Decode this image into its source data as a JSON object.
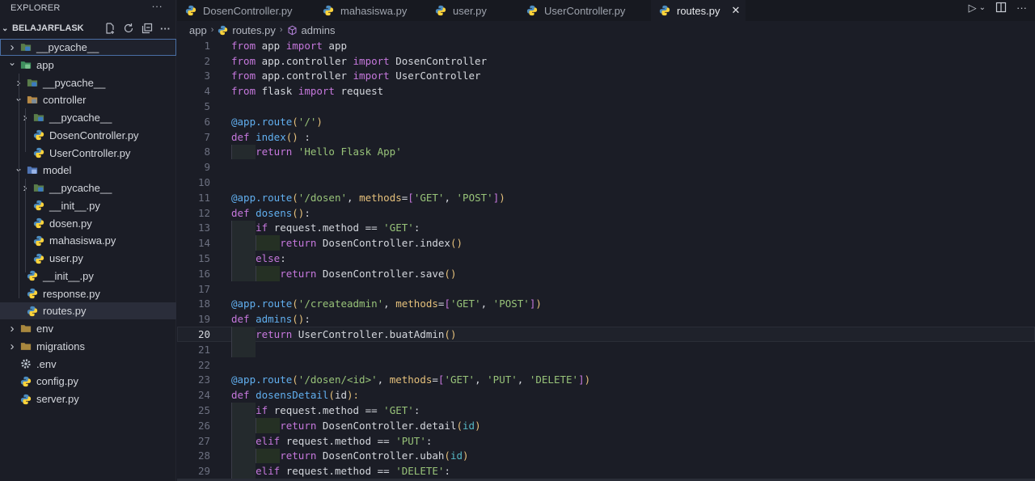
{
  "explorer": {
    "title": "EXPLORER",
    "more": "···",
    "project": "BELAJARFLASK",
    "actions": [
      "new-file-icon",
      "refresh-icon",
      "collapse-icon",
      "more-icon"
    ],
    "tree": [
      {
        "label": "__pycache__",
        "type": "pyfolder",
        "depth": 0,
        "chev": "›",
        "focused": true
      },
      {
        "label": "app",
        "type": "appfolder",
        "depth": 0,
        "chev": "⌄"
      },
      {
        "label": "__pycache__",
        "type": "pyfolder",
        "depth": 1,
        "chev": "›"
      },
      {
        "label": "controller",
        "type": "ctrlfolder",
        "depth": 1,
        "chev": "⌄"
      },
      {
        "label": "__pycache__",
        "type": "pyfolder",
        "depth": 2,
        "chev": "›"
      },
      {
        "label": "DosenController.py",
        "type": "py",
        "depth": 2
      },
      {
        "label": "UserController.py",
        "type": "py",
        "depth": 2
      },
      {
        "label": "model",
        "type": "modelfolder",
        "depth": 1,
        "chev": "⌄"
      },
      {
        "label": "__pycache__",
        "type": "pyfolder",
        "depth": 2,
        "chev": "›"
      },
      {
        "label": "__init__.py",
        "type": "py",
        "depth": 2
      },
      {
        "label": "dosen.py",
        "type": "py",
        "depth": 2
      },
      {
        "label": "mahasiswa.py",
        "type": "py",
        "depth": 2
      },
      {
        "label": "user.py",
        "type": "py",
        "depth": 2
      },
      {
        "label": "__init__.py",
        "type": "py",
        "depth": 1
      },
      {
        "label": "response.py",
        "type": "py",
        "depth": 1
      },
      {
        "label": "routes.py",
        "type": "py",
        "depth": 1,
        "selected": true
      },
      {
        "label": "env",
        "type": "folder",
        "depth": 0,
        "chev": "›"
      },
      {
        "label": "migrations",
        "type": "folder",
        "depth": 0,
        "chev": "›"
      },
      {
        "label": ".env",
        "type": "gear",
        "depth": 0
      },
      {
        "label": "config.py",
        "type": "py",
        "depth": 0
      },
      {
        "label": "server.py",
        "type": "py",
        "depth": 0
      }
    ]
  },
  "tabs": [
    {
      "label": "DosenController.py",
      "active": false
    },
    {
      "label": "mahasiswa.py",
      "active": false
    },
    {
      "label": "user.py",
      "active": false
    },
    {
      "label": "UserController.py",
      "active": false
    },
    {
      "label": "routes.py",
      "active": true,
      "close": "✕"
    }
  ],
  "breadcrumb": {
    "folder": "app",
    "file": "routes.py",
    "symbol": "admins"
  },
  "editor": {
    "current_line": 20,
    "lines": [
      [
        [
          "kw",
          "from"
        ],
        [
          "op",
          " app "
        ],
        [
          "kw",
          "import"
        ],
        [
          "op",
          " app"
        ]
      ],
      [
        [
          "kw",
          "from"
        ],
        [
          "op",
          " app.controller "
        ],
        [
          "kw",
          "import"
        ],
        [
          "op",
          " DosenController"
        ]
      ],
      [
        [
          "kw",
          "from"
        ],
        [
          "op",
          " app.controller "
        ],
        [
          "kw",
          "import"
        ],
        [
          "op",
          " UserController"
        ]
      ],
      [
        [
          "kw",
          "from"
        ],
        [
          "op",
          " flask "
        ],
        [
          "kw",
          "import"
        ],
        [
          "op",
          " request"
        ]
      ],
      [],
      [
        [
          "dec",
          "@app.route"
        ],
        [
          "br1",
          "("
        ],
        [
          "str",
          "'/'"
        ],
        [
          "br1",
          ")"
        ]
      ],
      [
        [
          "kw",
          "def"
        ],
        [
          "op",
          " "
        ],
        [
          "fn",
          "index"
        ],
        [
          "br1",
          "()"
        ],
        [
          "op",
          " :"
        ]
      ],
      [
        [
          "op",
          "    "
        ],
        [
          "kw",
          "return"
        ],
        [
          "op",
          " "
        ],
        [
          "str",
          "'Hello Flask App'"
        ]
      ],
      [],
      [],
      [
        [
          "dec",
          "@app.route"
        ],
        [
          "br1",
          "("
        ],
        [
          "str",
          "'/dosen'"
        ],
        [
          "op",
          ", "
        ],
        [
          "param",
          "methods"
        ],
        [
          "op",
          "="
        ],
        [
          "br2",
          "["
        ],
        [
          "str",
          "'GET'"
        ],
        [
          "op",
          ", "
        ],
        [
          "str",
          "'POST'"
        ],
        [
          "br2",
          "]"
        ],
        [
          "br1",
          ")"
        ]
      ],
      [
        [
          "kw",
          "def"
        ],
        [
          "op",
          " "
        ],
        [
          "fn",
          "dosens"
        ],
        [
          "br1",
          "()"
        ],
        [
          "op",
          ":"
        ]
      ],
      [
        [
          "op",
          "    "
        ],
        [
          "kw",
          "if"
        ],
        [
          "op",
          " request.method == "
        ],
        [
          "str",
          "'GET'"
        ],
        [
          "op",
          ":"
        ]
      ],
      [
        [
          "op",
          "        "
        ],
        [
          "kw",
          "return"
        ],
        [
          "op",
          " DosenController.index"
        ],
        [
          "br1",
          "()"
        ]
      ],
      [
        [
          "op",
          "    "
        ],
        [
          "kw",
          "else"
        ],
        [
          "op",
          ":"
        ]
      ],
      [
        [
          "op",
          "        "
        ],
        [
          "kw",
          "return"
        ],
        [
          "op",
          " DosenController.save"
        ],
        [
          "br1",
          "()"
        ]
      ],
      [],
      [
        [
          "dec",
          "@app.route"
        ],
        [
          "br1",
          "("
        ],
        [
          "str",
          "'/createadmin'"
        ],
        [
          "op",
          ", "
        ],
        [
          "param",
          "methods"
        ],
        [
          "op",
          "="
        ],
        [
          "br2",
          "["
        ],
        [
          "str",
          "'GET'"
        ],
        [
          "op",
          ", "
        ],
        [
          "str",
          "'POST'"
        ],
        [
          "br2",
          "]"
        ],
        [
          "br1",
          ")"
        ]
      ],
      [
        [
          "kw",
          "def"
        ],
        [
          "op",
          " "
        ],
        [
          "fn",
          "admins"
        ],
        [
          "br1",
          "()"
        ],
        [
          "op",
          ":"
        ]
      ],
      [
        [
          "op",
          "    "
        ],
        [
          "kw",
          "return"
        ],
        [
          "op",
          " UserController.buatAdmin"
        ],
        [
          "br1",
          "()"
        ]
      ],
      [],
      [],
      [
        [
          "dec",
          "@app.route"
        ],
        [
          "br1",
          "("
        ],
        [
          "str",
          "'/dosen/<id>'"
        ],
        [
          "op",
          ", "
        ],
        [
          "param",
          "methods"
        ],
        [
          "op",
          "="
        ],
        [
          "br2",
          "["
        ],
        [
          "str",
          "'GET'"
        ],
        [
          "op",
          ", "
        ],
        [
          "str",
          "'PUT'"
        ],
        [
          "op",
          ", "
        ],
        [
          "str",
          "'DELETE'"
        ],
        [
          "br2",
          "]"
        ],
        [
          "br1",
          ")"
        ]
      ],
      [
        [
          "kw",
          "def"
        ],
        [
          "op",
          " "
        ],
        [
          "fn",
          "dosensDetail"
        ],
        [
          "br1",
          "("
        ],
        [
          "op",
          "id"
        ],
        [
          "br1",
          "):"
        ]
      ],
      [
        [
          "op",
          "    "
        ],
        [
          "kw",
          "if"
        ],
        [
          "op",
          " request.method == "
        ],
        [
          "str",
          "'GET'"
        ],
        [
          "op",
          ":"
        ]
      ],
      [
        [
          "op",
          "        "
        ],
        [
          "kw",
          "return"
        ],
        [
          "op",
          " DosenController.detail"
        ],
        [
          "br1",
          "("
        ],
        [
          "arg",
          "id"
        ],
        [
          "br1",
          ")"
        ]
      ],
      [
        [
          "op",
          "    "
        ],
        [
          "kw",
          "elif"
        ],
        [
          "op",
          " request.method == "
        ],
        [
          "str",
          "'PUT'"
        ],
        [
          "op",
          ":"
        ]
      ],
      [
        [
          "op",
          "        "
        ],
        [
          "kw",
          "return"
        ],
        [
          "op",
          " DosenController.ubah"
        ],
        [
          "br1",
          "("
        ],
        [
          "arg",
          "id"
        ],
        [
          "br1",
          ")"
        ]
      ],
      [
        [
          "op",
          "    "
        ],
        [
          "kw",
          "elif"
        ],
        [
          "op",
          " request.method == "
        ],
        [
          "str",
          "'DELETE'"
        ],
        [
          "op",
          ":"
        ]
      ]
    ],
    "indent_levels": [
      0,
      0,
      0,
      0,
      0,
      0,
      0,
      1,
      0,
      0,
      0,
      0,
      1,
      2,
      1,
      2,
      0,
      0,
      0,
      1,
      1,
      0,
      0,
      0,
      1,
      2,
      1,
      2,
      1
    ]
  }
}
